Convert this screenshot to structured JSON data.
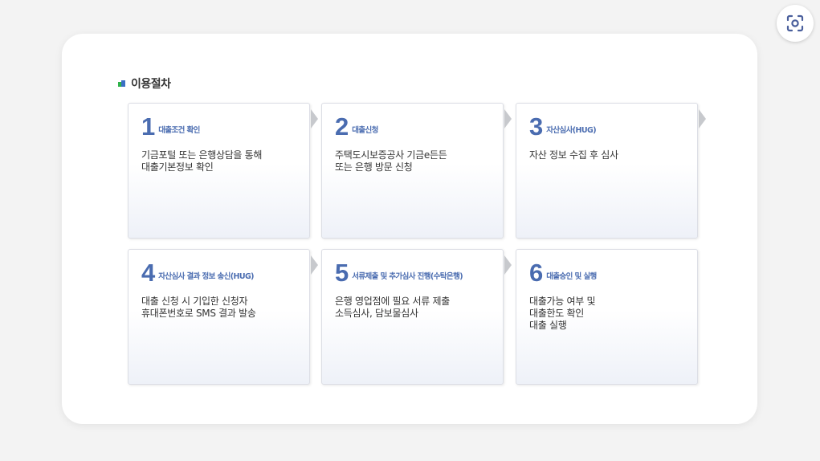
{
  "section_title": "이용절차",
  "steps": [
    {
      "num": "1",
      "title": "대출조건 확인",
      "desc": [
        "기금포털 또는 은행상담을 통해",
        "대출기본정보 확인"
      ]
    },
    {
      "num": "2",
      "title": "대출신청",
      "desc": [
        "주택도시보증공사 기금e든든",
        "또는 은행 방문 신청"
      ]
    },
    {
      "num": "3",
      "title": "자산심사(HUG)",
      "desc": [
        "자산 정보 수집 후 심사"
      ]
    },
    {
      "num": "4",
      "title": "자산심사 결과 정보 송신(HUG)",
      "desc": [
        "대출 신청 시 기입한 신청자",
        "휴대폰번호로 SMS 결과 발송"
      ]
    },
    {
      "num": "5",
      "title": "서류제출 및 추가심사 진행(수탁은행)",
      "desc": [
        "은행 영업점에 필요 서류 제출",
        "소득심사, 담보물심사"
      ]
    },
    {
      "num": "6",
      "title": "대출승인 및 실행",
      "desc": [
        "대출가능 여부 및",
        "대출한도 확인",
        "대출 실행"
      ]
    }
  ],
  "icons": {
    "lens_button": "google-lens-icon",
    "bullet": "colored-square-bullet-icon",
    "arrow": "chevron-right-arrow-icon"
  },
  "colors": {
    "accent": "#4a6cb0",
    "bullet_green": "#2fb34a",
    "bullet_blue": "#3a6fc4",
    "arrow": "#c7c9cd"
  }
}
